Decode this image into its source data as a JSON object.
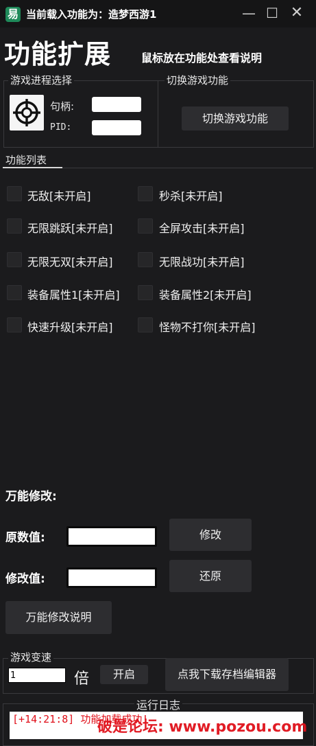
{
  "window": {
    "title": "当前载入功能为：造梦西游1",
    "logo_glyph": "易",
    "min_glyph": "—",
    "max_glyph": "☐",
    "close_glyph": "✕"
  },
  "header": {
    "title": "功能扩展",
    "hint": "鼠标放在功能处查看说明"
  },
  "process_group": {
    "title": "游戏进程选择",
    "icon": "crosshair-target-icon",
    "handle_label": "句柄:",
    "pid_label": "PID:",
    "handle_value": "",
    "pid_value": ""
  },
  "switch_group": {
    "title": "切换游戏功能",
    "button_label": "切换游戏功能"
  },
  "function_list": {
    "title": "功能列表",
    "items": [
      {
        "label": "无敌[未开启]",
        "checked": false
      },
      {
        "label": "秒杀[未开启]",
        "checked": false
      },
      {
        "label": "无限跳跃[未开启]",
        "checked": false
      },
      {
        "label": "全屏攻击[未开启]",
        "checked": false
      },
      {
        "label": "无限无双[未开启]",
        "checked": false
      },
      {
        "label": "无限战功[未开启]",
        "checked": false
      },
      {
        "label": "装备属性1[未开启]",
        "checked": false
      },
      {
        "label": "装备属性2[未开启]",
        "checked": false
      },
      {
        "label": "快速升级[未开启]",
        "checked": false
      },
      {
        "label": "怪物不打你[未开启]",
        "checked": false
      }
    ]
  },
  "modify": {
    "section_title": "万能修改:",
    "orig_label": "原数值:",
    "new_label": "修改值:",
    "orig_value": "",
    "new_value": "",
    "modify_button": "修改",
    "restore_button": "还原",
    "help_button": "万能修改说明"
  },
  "speed": {
    "title": "游戏变速",
    "value": "1",
    "unit": "倍",
    "start_button": "开启",
    "download_button": "点我下载存档编辑器"
  },
  "log": {
    "title": "运行日志",
    "entry": "[+14:21:8] 功能加载成功!"
  },
  "watermark": "破是论坛: www.pozou.com",
  "colors": {
    "background": "#1b1b1d",
    "titlebar": "#151516",
    "button": "#2d2d30",
    "log_text": "#e0101a",
    "logo": "#1f8a5a"
  }
}
